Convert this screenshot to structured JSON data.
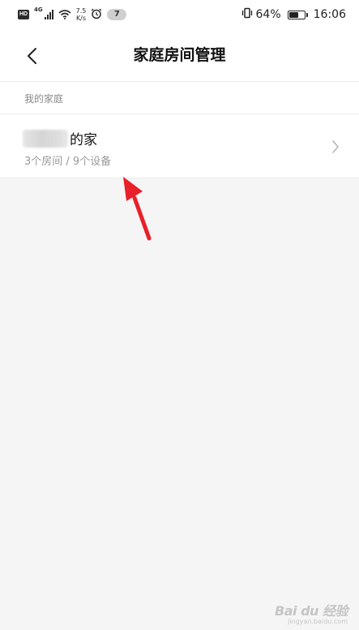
{
  "status_bar": {
    "hd": "HD",
    "network": "4G",
    "speed_value": "7.5",
    "speed_unit": "K/s",
    "notification_count": "7",
    "battery_percent": "64%",
    "battery_level": 0.64,
    "time": "16:06"
  },
  "header": {
    "title": "家庭房间管理"
  },
  "section": {
    "label": "我的家庭"
  },
  "home": {
    "name_suffix": "的家",
    "summary": "3个房间 / 9个设备"
  },
  "watermark": {
    "logo": "Bai du 经验",
    "url": "jingyan.baidu.com"
  },
  "colors": {
    "background": "#f5f5f5",
    "card": "#ffffff",
    "annotation_arrow": "#e8202a"
  }
}
